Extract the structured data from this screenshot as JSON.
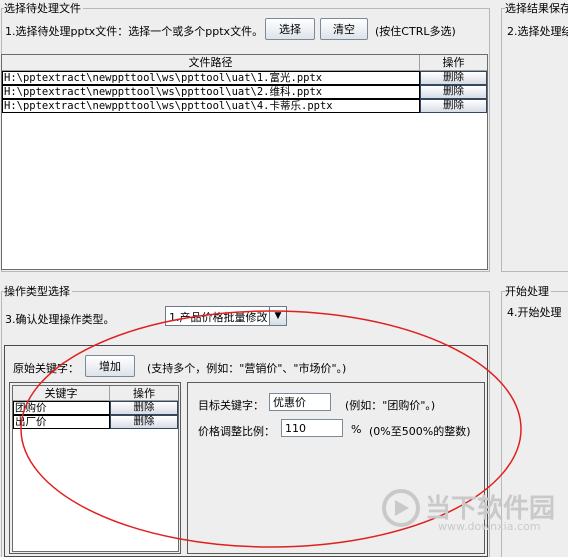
{
  "file_section": {
    "title": "选择待处理文件",
    "instruction": "1.选择待处理pptx文件：选择一个或多个pptx文件。",
    "select_button": "选择",
    "clear_button": "清空",
    "hint": "(按住CTRL多选)",
    "columns": [
      "文件路径",
      "操作"
    ],
    "rows": [
      {
        "path": "H:\\pptextract\\newppttool\\ws\\ppttool\\uat\\1.富光.pptx",
        "action": "删除"
      },
      {
        "path": "H:\\pptextract\\newppttool\\ws\\ppttool\\uat\\2.维科.pptx",
        "action": "删除"
      },
      {
        "path": "H:\\pptextract\\newppttool\\ws\\ppttool\\uat\\4.卡蒂乐.pptx",
        "action": "删除"
      }
    ]
  },
  "save_section": {
    "title": "选择结果保存",
    "instruction": "2.选择处理结"
  },
  "operation_section": {
    "title": "操作类型选择",
    "instruction": "3.确认处理操作类型。",
    "selected_type": "1.产品价格批量修改",
    "original_keyword_label": "原始关键字：",
    "add_button": "增加",
    "support_hint": "(支持多个，例如：\"营销价\"、\"市场价\"。)",
    "keyword_columns": [
      "关键字",
      "操作"
    ],
    "keyword_rows": [
      {
        "keyword": "团购价",
        "action": "删除"
      },
      {
        "keyword": "出厂价",
        "action": "删除"
      }
    ],
    "target_keyword_label": "目标关键字：",
    "target_keyword_value": "优惠价",
    "target_keyword_hint": "(例如：\"团购价\"。)",
    "ratio_label": "价格调整比例：",
    "ratio_value": "110",
    "ratio_unit": "%",
    "ratio_hint": "(0%至500%的整数)"
  },
  "start_section": {
    "title": "开始处理",
    "instruction": "4.开始处理"
  },
  "watermark": {
    "cn": "当下软件园",
    "en": "www.downxia.com"
  },
  "colors": {
    "background": "#eeeeee",
    "annotation_ellipse": "#e02020"
  }
}
